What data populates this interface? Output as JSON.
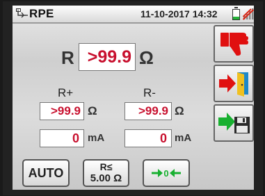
{
  "header": {
    "mode_title": "RPE",
    "datetime": "11-10-2017 14:32",
    "battery_level": 0.3
  },
  "main": {
    "r_label": "R",
    "r_value": ">99.9",
    "r_unit": "Ω",
    "r_plus_label": "R+",
    "r_plus_value": ">99.9",
    "r_plus_unit": "Ω",
    "r_plus_current": "0",
    "r_plus_current_unit": "mA",
    "r_minus_label": "R-",
    "r_minus_value": ">99.9",
    "r_minus_unit": "Ω",
    "r_minus_current": "0",
    "r_minus_current_unit": "mA"
  },
  "buttons": {
    "auto_label": "AUTO",
    "limit_top": "R≤",
    "limit_value": "5.00 Ω"
  },
  "colors": {
    "value_red": "#c8102e",
    "thumb_red": "#e01010",
    "arrow_green": "#18b030"
  }
}
